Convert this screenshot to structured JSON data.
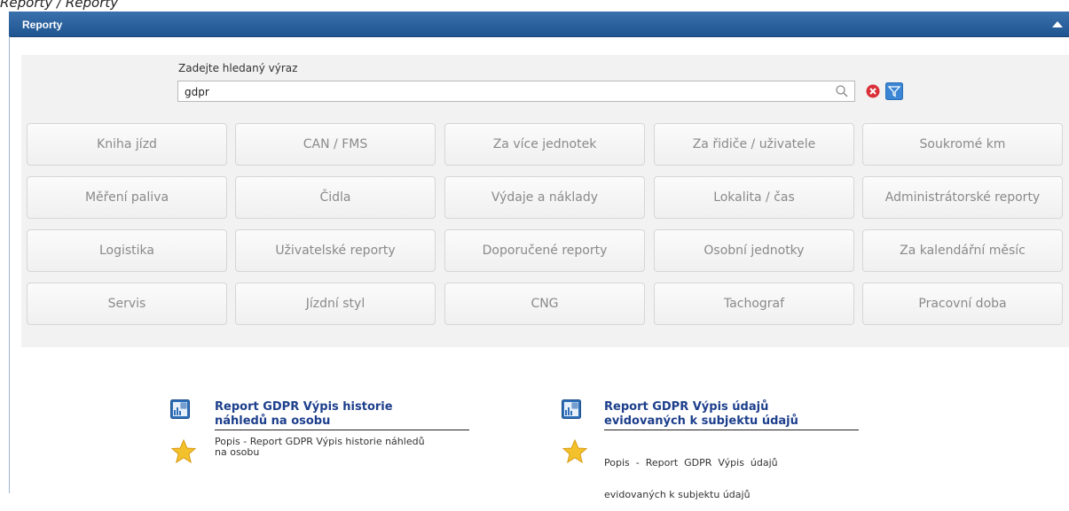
{
  "breadcrumb": "Reporty / Reporty",
  "panel": {
    "title": "Reporty"
  },
  "search": {
    "label": "Zadejte hledaný výraz",
    "value": "gdpr"
  },
  "categories": [
    "Kniha jízd",
    "CAN / FMS",
    "Za více jednotek",
    "Za řidiče / uživatele",
    "Soukromé km",
    "Měření paliva",
    "Čidla",
    "Výdaje a náklady",
    "Lokalita / čas",
    "Administrátorské reporty",
    "Logistika",
    "Uživatelské reporty",
    "Doporučené reporty",
    "Osobní jednotky",
    "Za kalendářní měsíc",
    "Servis",
    "Jízdní styl",
    "CNG",
    "Tachograf",
    "Pracovní doba"
  ],
  "results": [
    {
      "title_line1": "Report GDPR Výpis historie",
      "title_line2": "náhledů na osobu",
      "desc_line1": "Popis - Report GDPR Výpis historie náhledů",
      "desc_line2": "na osobu"
    },
    {
      "title_line1": "Report GDPR Výpis údajů",
      "title_line2": "evidovaných k subjektu údajů",
      "desc_line1": "Popis  -  Report  GDPR  Výpis  údajů",
      "desc_line2": "evidovaných k subjektu údajů"
    }
  ],
  "colors": {
    "header": "#2b619e",
    "link": "#1d3f8c",
    "filter_blue": "#3a86d4",
    "clear_red": "#d9313a",
    "star": "#f3c12b"
  }
}
